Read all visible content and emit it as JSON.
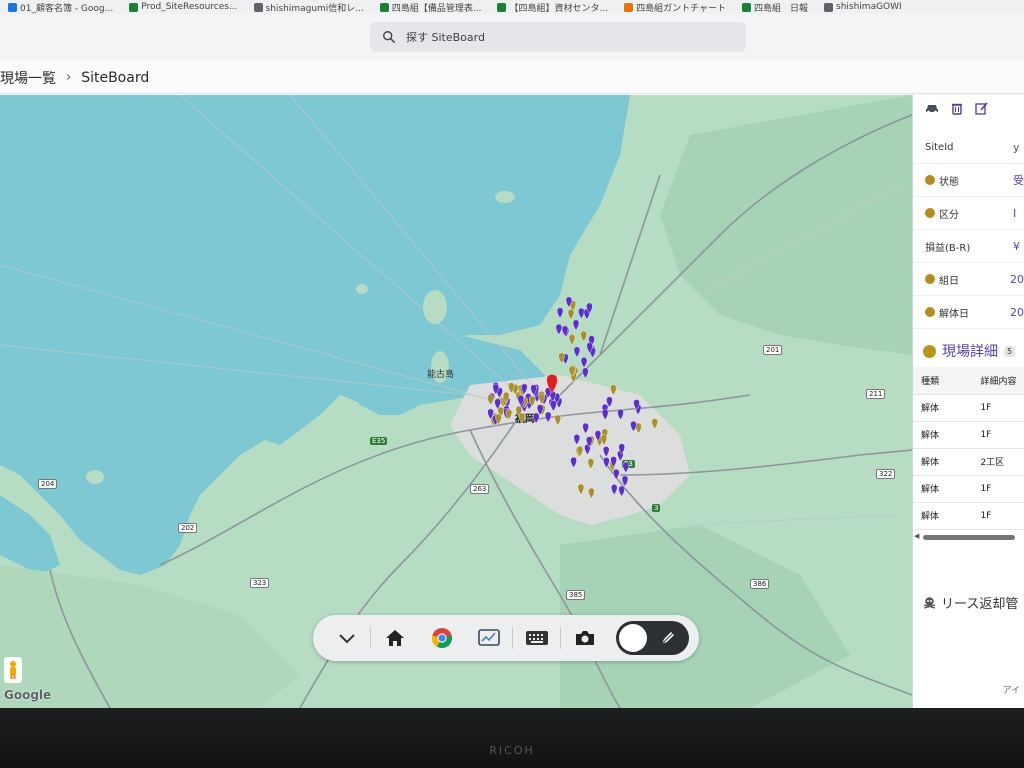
{
  "bookmarks": [
    {
      "label": "01_顧客名簿 - Goog...",
      "color": "#1a73e8"
    },
    {
      "label": "Prod_SiteResources...",
      "color": "#188038"
    },
    {
      "label": "shishimagumi信和レ...",
      "color": "#5f6368"
    },
    {
      "label": "四島組【備品管理表...",
      "color": "#188038"
    },
    {
      "label": "【四島組】資材センタ...",
      "color": "#188038"
    },
    {
      "label": "四島組ガントチャート",
      "color": "#e37400"
    },
    {
      "label": "四島組　日報",
      "color": "#188038"
    },
    {
      "label": "shishimaGOWI",
      "color": "#5f6368"
    }
  ],
  "search": {
    "placeholder": "探す SiteBoard"
  },
  "breadcrumb": {
    "parent": "現場一覧",
    "separator": "›",
    "current": "SiteBoard"
  },
  "map": {
    "labels": [
      {
        "text": "能古島"
      },
      {
        "text": "福岡"
      }
    ],
    "route_shields": [
      "204",
      "202",
      "E35",
      "263",
      "E3",
      "385",
      "323",
      "201",
      "211",
      "322",
      "386",
      "3"
    ],
    "google_text": "Google",
    "marker_colors": {
      "purple": "#5b2fc9",
      "olive": "#a8902a",
      "selected": "#e02020"
    }
  },
  "toolbar": {
    "items": [
      "chevron-down",
      "home",
      "chrome",
      "whiteboard",
      "keyboard",
      "camera",
      "pen-toggle"
    ]
  },
  "panel": {
    "props": [
      {
        "label": "SiteId",
        "value": "y",
        "dot": false
      },
      {
        "label": "状態",
        "value": "受",
        "dot": true
      },
      {
        "label": "区分",
        "value": "I",
        "dot": true
      },
      {
        "label": "損益(B-R)",
        "value": "¥",
        "dot": false
      },
      {
        "label": "組日",
        "value": "20",
        "dot": true
      },
      {
        "label": "解体日",
        "value": "20",
        "dot": true
      }
    ],
    "detail_title": "現場詳細",
    "detail_count": "5",
    "table_headers": [
      "種類",
      "詳細内容"
    ],
    "table_rows": [
      [
        "解体",
        "1F"
      ],
      [
        "解体",
        "1F"
      ],
      [
        "解体",
        "2工区"
      ],
      [
        "解体",
        "1F"
      ],
      [
        "解体",
        "1F"
      ]
    ],
    "lease_title": "リース返却管",
    "footer": "アイ"
  },
  "bezel": {
    "brand": "RICOH"
  }
}
